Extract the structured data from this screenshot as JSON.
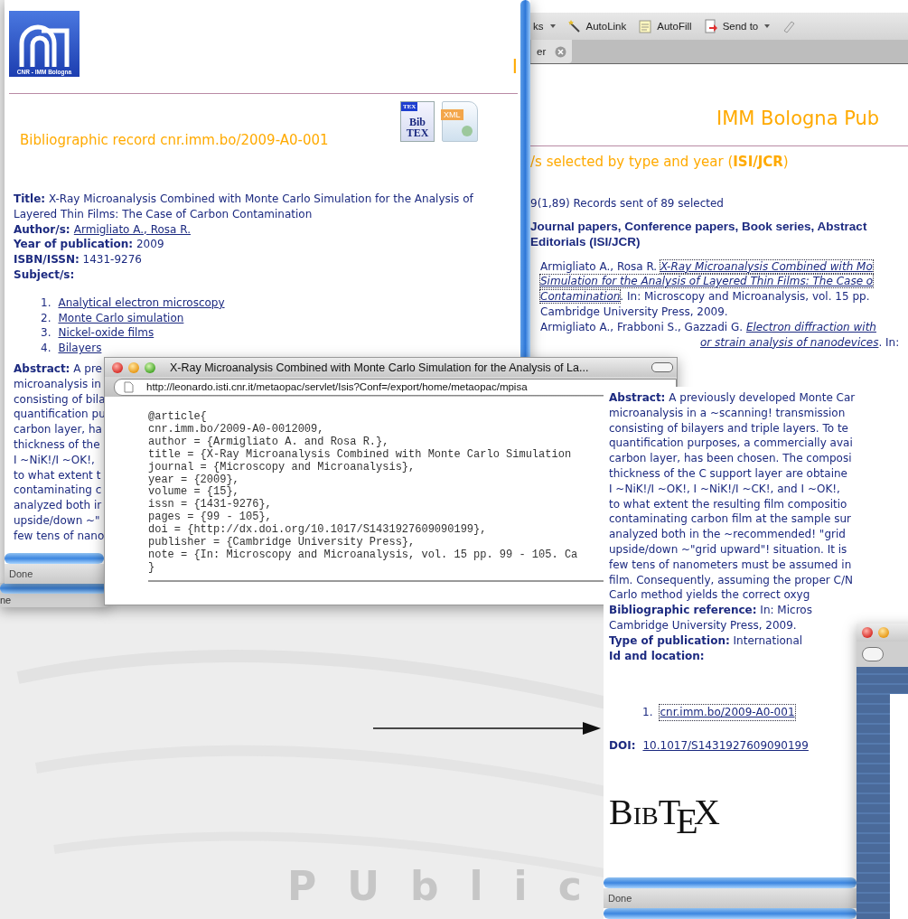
{
  "background": {
    "caption": "PUblic"
  },
  "results_window": {
    "toolbar": [
      {
        "label": "ks",
        "kind": "menu"
      },
      {
        "label": "AutoLink",
        "kind": "wand"
      },
      {
        "label": "AutoFill",
        "kind": "note"
      },
      {
        "label": "Send to",
        "kind": "send-menu"
      },
      {
        "kind": "pen"
      }
    ],
    "tab": {
      "label": "er"
    },
    "heading": "IMM Bologna Pub",
    "subtitle": "/s selected by type and year (**ISI/JCR**)",
    "records": "9(1,89) Records sent of 89 selected",
    "section_lines": [
      "Journal papers, Conference papers, Book series, Abstract",
      "Editorials (ISI/JCR)"
    ],
    "entries": [
      [
        [
          {
            "text": "Armigliato A., Rosa R. ",
            "kind": "plain"
          },
          {
            "text": "X-Ray Microanalysis Combined with Mo",
            "kind": "italic_link",
            "focused": true
          }
        ],
        [
          {
            "text": "Simulation for the Analysis of Layered Thin Films: The Case o",
            "kind": "italic_link",
            "focused": true
          }
        ],
        [
          {
            "text": "Contamination",
            "kind": "italic_link",
            "focused": true
          },
          {
            "text": ". In: Microscopy and Microanalysis, vol. 15 pp.",
            "kind": "plain"
          }
        ],
        [
          {
            "text": "Cambridge University Press, 2009.",
            "kind": "plain"
          }
        ]
      ],
      [
        [
          {
            "text": "Armigliato A., Frabboni S., Gazzadi G. ",
            "kind": "plain"
          },
          {
            "text": "Electron diffraction with",
            "kind": "italic_link",
            "focused": false
          }
        ]
      ]
    ],
    "covered_line": [
      {
        "text": "or strain analysis of nanodevices",
        "kind": "italic_link",
        "focused": false
      },
      {
        "text": ". In:",
        "kind": "plain"
      }
    ]
  },
  "record_window": {
    "logo_caption": "CNR - IMM Bologna",
    "heading": "I",
    "record_title": "Bibliographic record cnr.imm.bo/2009-A0-001",
    "export_icons": [
      {
        "kind": "bibtex",
        "badge": "TEX",
        "lines": [
          "Bib",
          "TEX"
        ]
      },
      {
        "kind": "xml",
        "badge": "XML"
      }
    ],
    "record_lines": [
      [
        {
          "text": "Title:",
          "kind": "label"
        },
        {
          "text": " X-Ray Microanalysis Combined with Monte Carlo Simulation for the Analysis of",
          "kind": "plain"
        }
      ],
      [
        {
          "text": "Layered Thin Films: The Case of Carbon Contamination",
          "kind": "plain"
        }
      ],
      [
        {
          "text": "Author/s:",
          "kind": "label"
        },
        {
          "text": "Armigliato A., Rosa R.",
          "kind": "link",
          "focused": false
        }
      ],
      [
        {
          "text": "Year of publication:",
          "kind": "label"
        },
        {
          "text": " 2009",
          "kind": "plain"
        }
      ],
      [
        {
          "text": "ISBN/ISSN:",
          "kind": "label"
        },
        {
          "text": " 1431-9276",
          "kind": "plain"
        }
      ],
      [
        {
          "text": "Subject/s:",
          "kind": "label"
        }
      ]
    ],
    "subjects": [
      {
        "number": "1.",
        "label": "Analytical electron microscopy"
      },
      {
        "number": "2.",
        "label": "Monte Carlo simulation"
      },
      {
        "number": "3.",
        "label": "Nickel-oxide films"
      },
      {
        "number": "4.",
        "label": "Bilayers"
      }
    ],
    "abstract_lines": [
      [
        {
          "text": "Abstract:",
          "kind": "label"
        },
        {
          "text": " A pre",
          "kind": "plain"
        }
      ],
      [
        {
          "text": "microanalysis in",
          "kind": "plain"
        }
      ],
      [
        {
          "text": "consisting of bila",
          "kind": "plain"
        }
      ],
      [
        {
          "text": "quantification pu",
          "kind": "plain"
        }
      ],
      [
        {
          "text": "carbon layer, ha",
          "kind": "plain"
        }
      ],
      [
        {
          "text": "thickness of the",
          "kind": "plain"
        }
      ],
      [
        {
          "text": "I ~NiK!/I ~OK!,",
          "kind": "plain"
        }
      ],
      [
        {
          "text": "to what extent t",
          "kind": "plain"
        }
      ],
      [
        {
          "text": "contaminating c",
          "kind": "plain"
        }
      ],
      [
        {
          "text": "analyzed both ir",
          "kind": "plain"
        }
      ],
      [
        {
          "text": "upside/down ~\"",
          "kind": "plain"
        }
      ],
      [
        {
          "text": "few tens of nano",
          "kind": "plain"
        }
      ]
    ],
    "status": "Done"
  },
  "under_window": {
    "status": "ne"
  },
  "bibtex_popup": {
    "title": "X-Ray Microanalysis Combined with Monte Carlo Simulation for the Analysis of La...",
    "url": "http://leonardo.isti.cnr.it/metaopac/servlet/Isis?Conf=/export/home/metaopac/mpisa",
    "code_lines": [
      "@article{",
      "cnr.imm.bo/2009-A0-0012009,",
      "author = {Armigliato A. and Rosa R.},",
      "title = {X-Ray Microanalysis Combined with Monte Carlo Simulation",
      "journal = {Microscopy and Microanalysis},",
      "year = {2009},",
      "volume = {15},",
      "issn = {1431-9276},",
      "pages = {99 - 105},",
      "doi = {http://dx.doi.org/10.1017/S1431927609090199},",
      "publisher = {Cambridge University Press},",
      "note = {In: Microscopy and Microanalysis, vol. 15 pp. 99 - 105. Ca",
      "}"
    ]
  },
  "detail_window": {
    "lines": [
      [
        {
          "text": "Abstract:",
          "kind": "label"
        },
        {
          "text": " A previously developed Monte Car",
          "kind": "plain"
        }
      ],
      [
        {
          "text": "microanalysis in a ~scanning! transmission",
          "kind": "plain"
        }
      ],
      [
        {
          "text": "consisting of bilayers and triple layers. To te",
          "kind": "plain"
        }
      ],
      [
        {
          "text": "quantification purposes, a commercially avai",
          "kind": "plain"
        }
      ],
      [
        {
          "text": "carbon layer, has been chosen. The composi",
          "kind": "plain"
        }
      ],
      [
        {
          "text": "thickness of the C support layer are obtaine",
          "kind": "plain"
        }
      ],
      [
        {
          "text": "I ~NiK!/I ~OK!, I ~NiK!/I ~CK!, and I ~OK!,",
          "kind": "plain"
        }
      ],
      [
        {
          "text": "to what extent the resulting film compositio",
          "kind": "plain"
        }
      ],
      [
        {
          "text": "contaminating carbon film at the sample sur",
          "kind": "plain"
        }
      ],
      [
        {
          "text": "analyzed both in the ~recommended! \"grid",
          "kind": "plain"
        }
      ],
      [
        {
          "text": "upside/down ~\"grid upward\"! situation. It is",
          "kind": "plain"
        }
      ],
      [
        {
          "text": "few tens of nanometers must be assumed in",
          "kind": "plain"
        }
      ],
      [
        {
          "text": "film. Consequently, assuming the proper C/N",
          "kind": "plain"
        }
      ],
      [
        {
          "text": "Carlo method yields the correct oxyg",
          "kind": "plain"
        }
      ],
      [
        {
          "text": "Bibliographic reference:",
          "kind": "label"
        },
        {
          "text": " In: Micros",
          "kind": "plain"
        }
      ],
      [
        {
          "text": "Cambridge University Press, 2009.",
          "kind": "plain"
        }
      ],
      [
        {
          "text": "Type of publication:",
          "kind": "label"
        },
        {
          "text": " International",
          "kind": "plain"
        }
      ],
      [
        {
          "text": "Id and location:",
          "kind": "label"
        }
      ]
    ],
    "locations": [
      {
        "number": "1.",
        "label": "cnr.imm.bo/2009-A0-001",
        "focused": true
      }
    ],
    "doi_label": "DOI:",
    "doi": "10.1017/S1431927609090199",
    "logo": "BibT$_{E}$X",
    "status": "Done"
  }
}
